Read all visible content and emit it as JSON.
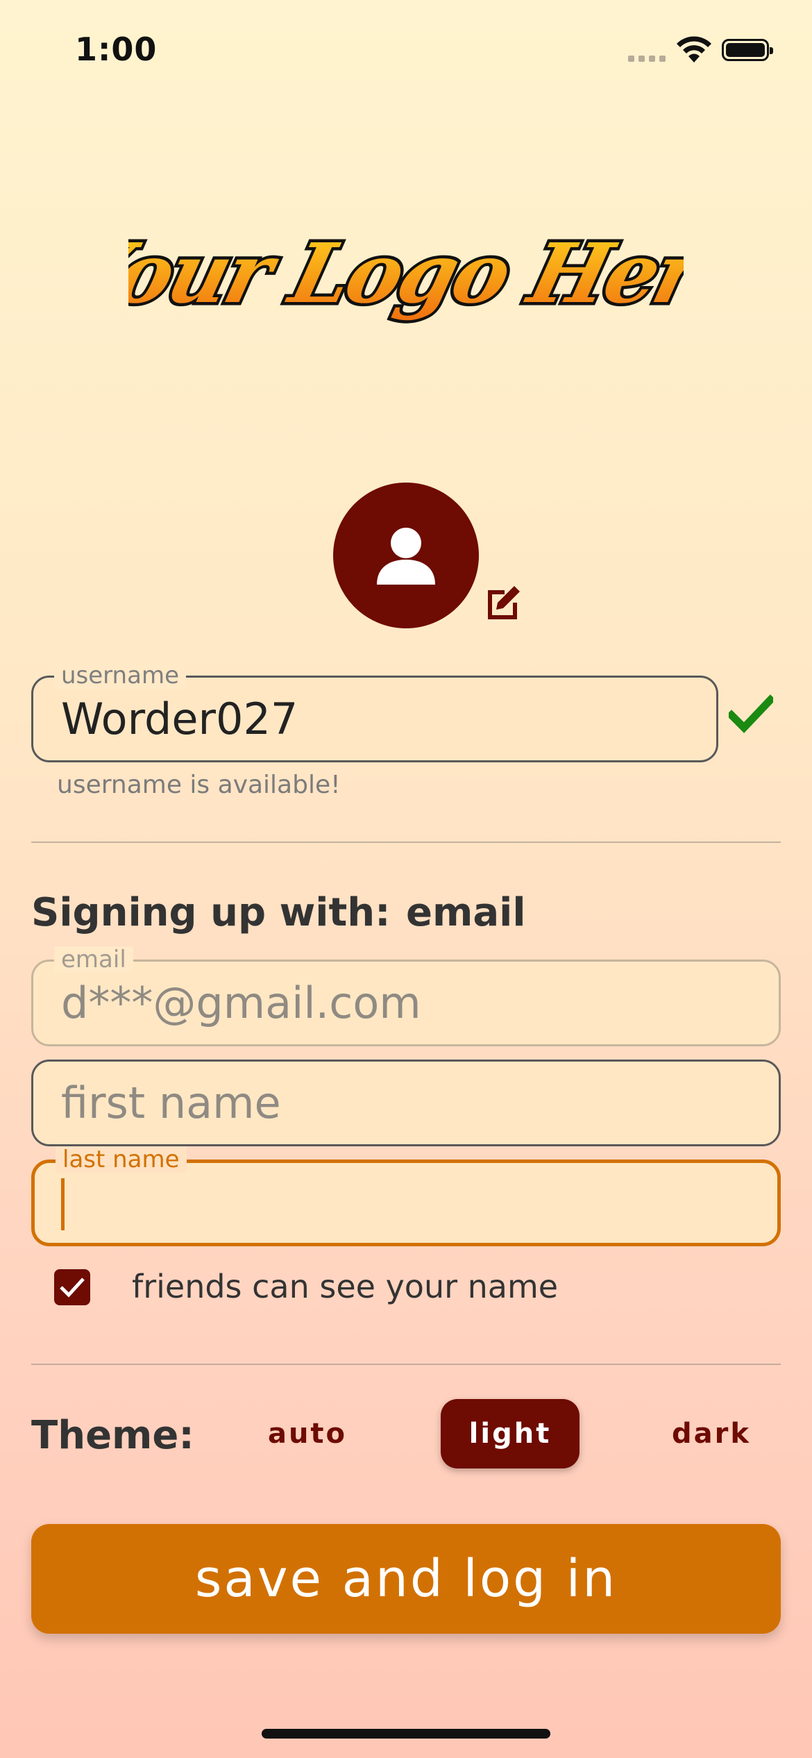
{
  "status_bar": {
    "time": "1:00"
  },
  "logo": {
    "text": "Your Logo Here"
  },
  "profile": {
    "username_label": "username",
    "username_value": "Worder027",
    "username_helper": "username is available!"
  },
  "signup": {
    "label": "Signing up with:",
    "method": "email",
    "email_label": "email",
    "email_value": "d***@gmail.com",
    "first_name_placeholder": "first name",
    "last_name_label": "last name",
    "last_name_value": "",
    "friends_visibility_label": "friends can see your name",
    "friends_visibility_checked": true
  },
  "theme": {
    "label": "Theme:",
    "options": [
      "auto",
      "light",
      "dark"
    ],
    "selected": "light"
  },
  "actions": {
    "save_label": "save and log in"
  },
  "colors": {
    "accent": "#d27103",
    "brand_dark": "#6e0b02",
    "success": "#1a8a12"
  }
}
